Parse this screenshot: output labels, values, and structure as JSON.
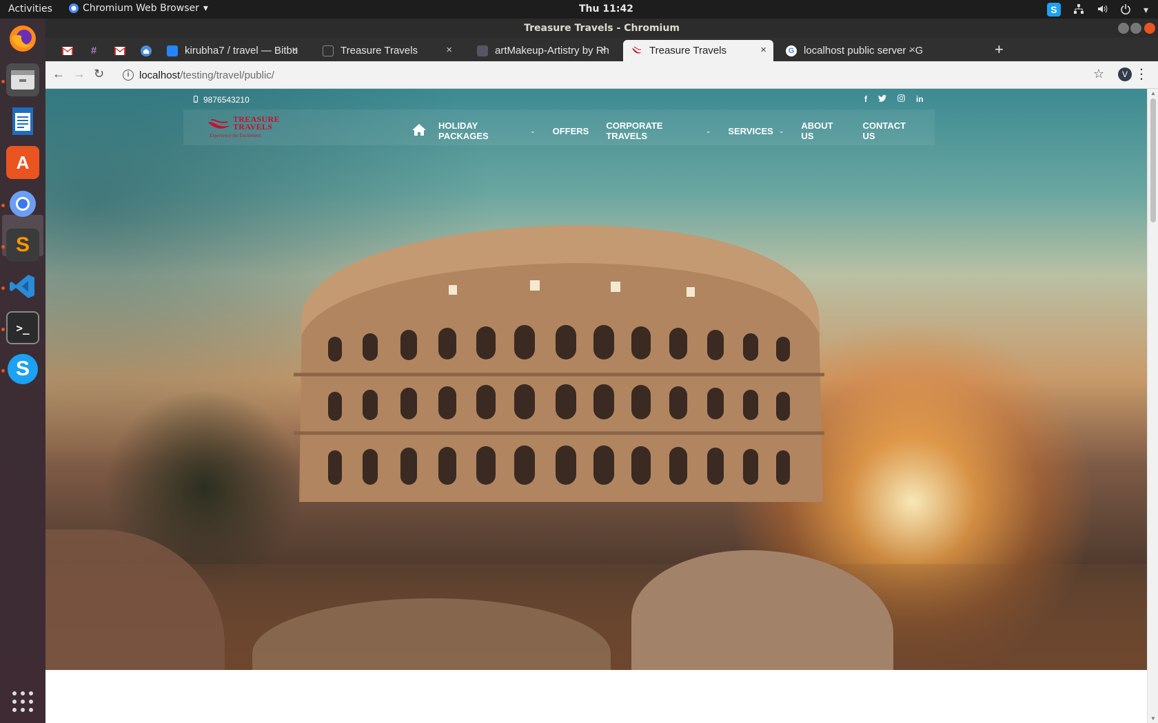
{
  "system_bar": {
    "activities": "Activities",
    "app_name": "Chromium Web Browser",
    "app_caret": "▾",
    "clock": "Thu 11:42",
    "skype_tray": "S"
  },
  "dock": {
    "items": [
      "firefox",
      "files",
      "libreoffice-writer",
      "ubuntu-software",
      "chromium",
      "sublime-text",
      "vscode",
      "terminal",
      "skype"
    ],
    "terminal_glyph": ">_",
    "sublime_glyph": "S",
    "skype_glyph": "S",
    "software_glyph": "A",
    "apps_grid": "⋮⋮⋮"
  },
  "window": {
    "title": "Treasure Travels - Chromium"
  },
  "tabs": [
    {
      "title": "kirubha7 / travel — Bitbu",
      "favicon": "bitbucket-icon"
    },
    {
      "title": "Treasure Travels",
      "favicon": "page-icon"
    },
    {
      "title": "artMakeup-Artistry by Rh",
      "favicon": "site-icon"
    },
    {
      "title": "Treasure Travels",
      "favicon": "treasure-travels-icon",
      "active": true
    },
    {
      "title": "localhost public server - G",
      "favicon": "google-icon"
    }
  ],
  "pinned_tabs": [
    "gmail-icon",
    "slack-icon",
    "gmail-icon",
    "inbox-icon"
  ],
  "toolbar": {
    "url_host": "localhost",
    "url_path": "/testing/travel/public/",
    "profile_initial": "V"
  },
  "site": {
    "phone": "9876543210",
    "logo": {
      "brand_line1": "TREASURE",
      "brand_line2": "TRAVELS",
      "tagline": "Experience the Excitement"
    },
    "social": [
      "f",
      "t",
      "ig",
      "in"
    ],
    "nav": [
      {
        "label": "HOLIDAY PACKAGES",
        "dropdown": true
      },
      {
        "label": "OFFERS",
        "dropdown": false
      },
      {
        "label": "CORPORATE TRAVELS",
        "dropdown": true
      },
      {
        "label": "SERVICES",
        "dropdown": true
      },
      {
        "label": "ABOUT US",
        "dropdown": false
      },
      {
        "label": "CONTACT US",
        "dropdown": false
      }
    ],
    "caret": "⌄"
  },
  "colors": {
    "brand_red": "#c8102e",
    "ubuntu_orange": "#e95420",
    "dock_bg": "#3a2f35"
  }
}
